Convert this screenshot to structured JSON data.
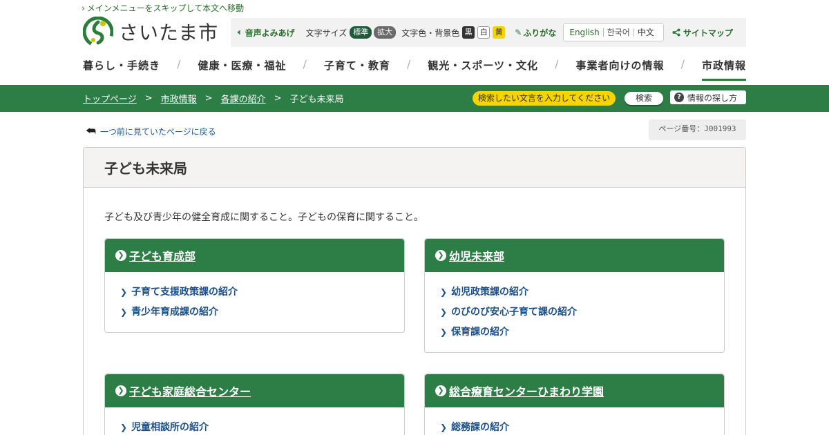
{
  "skip_link": "メインメニューをスキップして本文へ移動",
  "logo": {
    "text": "さいたま市",
    "brand_green": "#2a7d3a",
    "brand_yellow": "#c9c400"
  },
  "utility": {
    "voice": "音声よみあげ",
    "font_size_label": "文字サイズ",
    "font_standard": "標準",
    "font_large": "拡大",
    "color_label": "文字色・背景色",
    "color_black": "黒",
    "color_white": "白",
    "color_yellow": "黄",
    "furigana": "ふりがな",
    "languages": [
      "English",
      "한국어",
      "中文"
    ],
    "sitemap": "サイトマップ"
  },
  "gnav": [
    {
      "label": "暮らし・手続き",
      "active": false
    },
    {
      "label": "健康・医療・福祉",
      "active": false
    },
    {
      "label": "子育て・教育",
      "active": false
    },
    {
      "label": "観光・スポーツ・文化",
      "active": false
    },
    {
      "label": "事業者向けの情報",
      "active": false
    },
    {
      "label": "市政情報",
      "active": true
    }
  ],
  "gnav_separator": "/",
  "breadcrumb": {
    "items": [
      "トップページ",
      "市政情報",
      "各課の紹介"
    ],
    "current": "子ども未来局",
    "separator": ">"
  },
  "search": {
    "placeholder": "検索したい文言を入力してください",
    "button": "検索",
    "howto": "情報の探し方"
  },
  "back_link": "一つ前に見ていたページに戻る",
  "page_number": "ページ番号：J001993",
  "page": {
    "title": "子ども未来局",
    "description": "子ども及び青少年の健全育成に関すること。子どもの保育に関すること。"
  },
  "sections": [
    {
      "title": "子ども育成部",
      "links": [
        "子育て支援政策課の紹介",
        "青少年育成課の紹介"
      ]
    },
    {
      "title": "幼児未来部",
      "links": [
        "幼児政策課の紹介",
        "のびのび安心子育て課の紹介",
        "保育課の紹介"
      ]
    },
    {
      "title": "子ども家庭総合センター",
      "links": [
        "児童相談所の紹介"
      ]
    },
    {
      "title": "総合療育センターひまわり学園",
      "links": [
        "総務課の紹介"
      ]
    }
  ],
  "colors": {
    "header_green": "#2d7d46",
    "link_blue": "#1a4f8a",
    "search_yellow": "#f5d400"
  }
}
